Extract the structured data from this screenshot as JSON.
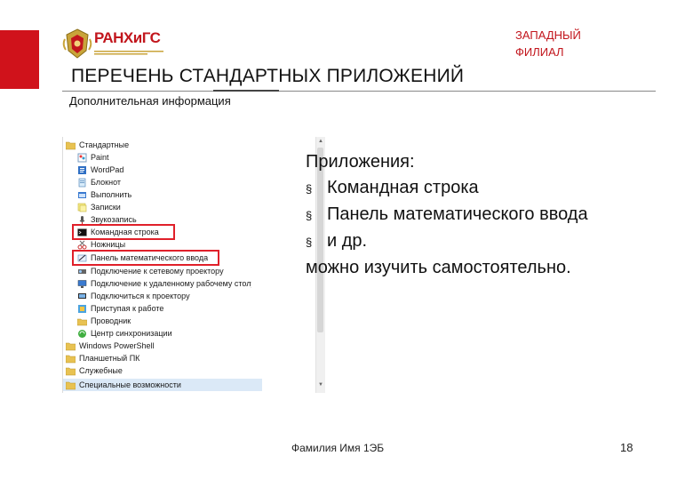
{
  "header": {
    "logo_text": "РАНХиГС",
    "branch_line1": "ЗАПАДНЫЙ",
    "branch_line2": "ФИЛИАЛ"
  },
  "slide": {
    "title": "ПЕРЕЧЕНЬ СТАНДАРТНЫХ ПРИЛОЖЕНИЙ",
    "subtitle": "Дополнительная информация"
  },
  "start_menu": {
    "items": [
      {
        "label": "Стандартные",
        "icon": "folder-icon"
      },
      {
        "label": "Paint",
        "icon": "paint-icon"
      },
      {
        "label": "WordPad",
        "icon": "wordpad-icon"
      },
      {
        "label": "Блокнот",
        "icon": "notepad-icon"
      },
      {
        "label": "Выполнить",
        "icon": "run-icon"
      },
      {
        "label": "Записки",
        "icon": "sticky-notes-icon"
      },
      {
        "label": "Звукозапись",
        "icon": "microphone-icon"
      },
      {
        "label": "Командная строка",
        "icon": "cmd-icon"
      },
      {
        "label": "Ножницы",
        "icon": "scissors-icon"
      },
      {
        "label": "Панель математического ввода",
        "icon": "math-input-icon"
      },
      {
        "label": "Подключение к сетевому проектору",
        "icon": "projector-icon"
      },
      {
        "label": "Подключение к удаленному рабочему столу",
        "icon": "remote-desktop-icon"
      },
      {
        "label": "Подключиться к проектору",
        "icon": "projector-icon"
      },
      {
        "label": "Приступая к работе",
        "icon": "getting-started-icon"
      },
      {
        "label": "Проводник",
        "icon": "explorer-icon"
      },
      {
        "label": "Центр синхронизации",
        "icon": "sync-icon"
      },
      {
        "label": "Windows PowerShell",
        "icon": "folder-icon"
      },
      {
        "label": "Планшетный ПК",
        "icon": "folder-icon"
      },
      {
        "label": "Служебные",
        "icon": "folder-icon"
      },
      {
        "label": "Специальные возможности",
        "icon": "folder-icon"
      }
    ]
  },
  "content": {
    "heading": "Приложения:",
    "bullets": [
      "Командная строка",
      "Панель математического ввода",
      "и др."
    ],
    "closing": "можно изучить самостоятельно.",
    "bullet_marker": "§"
  },
  "footer": {
    "name": "Фамилия Имя 1ЭБ",
    "page": "18"
  },
  "colors": {
    "accent_red": "#d0121b",
    "highlight_red": "#e0202a",
    "folder_yellow": "#e8c252"
  }
}
